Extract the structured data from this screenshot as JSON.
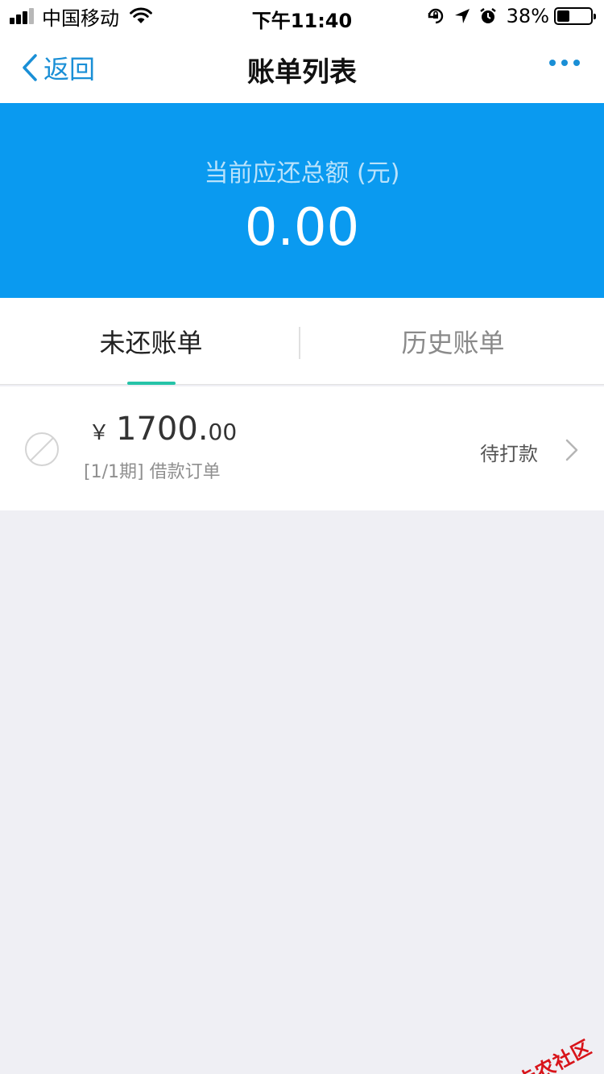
{
  "status_bar": {
    "carrier": "中国移动",
    "time": "下午11:40",
    "battery_percent": "38%",
    "battery_level": 0.38,
    "icons": [
      "signal-icon",
      "wifi-icon",
      "rotation-lock-icon",
      "location-arrow-icon",
      "alarm-icon",
      "battery-icon"
    ]
  },
  "nav": {
    "back_label": "返回",
    "title": "账单列表",
    "more_icon": "more-dots-icon"
  },
  "summary": {
    "label": "当前应还总额 (元)",
    "amount": "0.00"
  },
  "tabs": [
    {
      "label": "未还账单",
      "active": true
    },
    {
      "label": "历史账单",
      "active": false
    }
  ],
  "bills": [
    {
      "currency": "￥",
      "amount_int": "1700.",
      "amount_dec": "00",
      "description": "[1/1期] 借款订单",
      "status": "待打款",
      "icon": "disabled-circle-icon"
    }
  ],
  "watermark": {
    "text": "卡农社区"
  },
  "colors": {
    "header_blue": "#0a9af0",
    "accent_blue": "#1a8fd6",
    "tab_indicator": "#26c3a8",
    "page_bg": "#efeff4",
    "watermark_red": "#d8141a"
  }
}
